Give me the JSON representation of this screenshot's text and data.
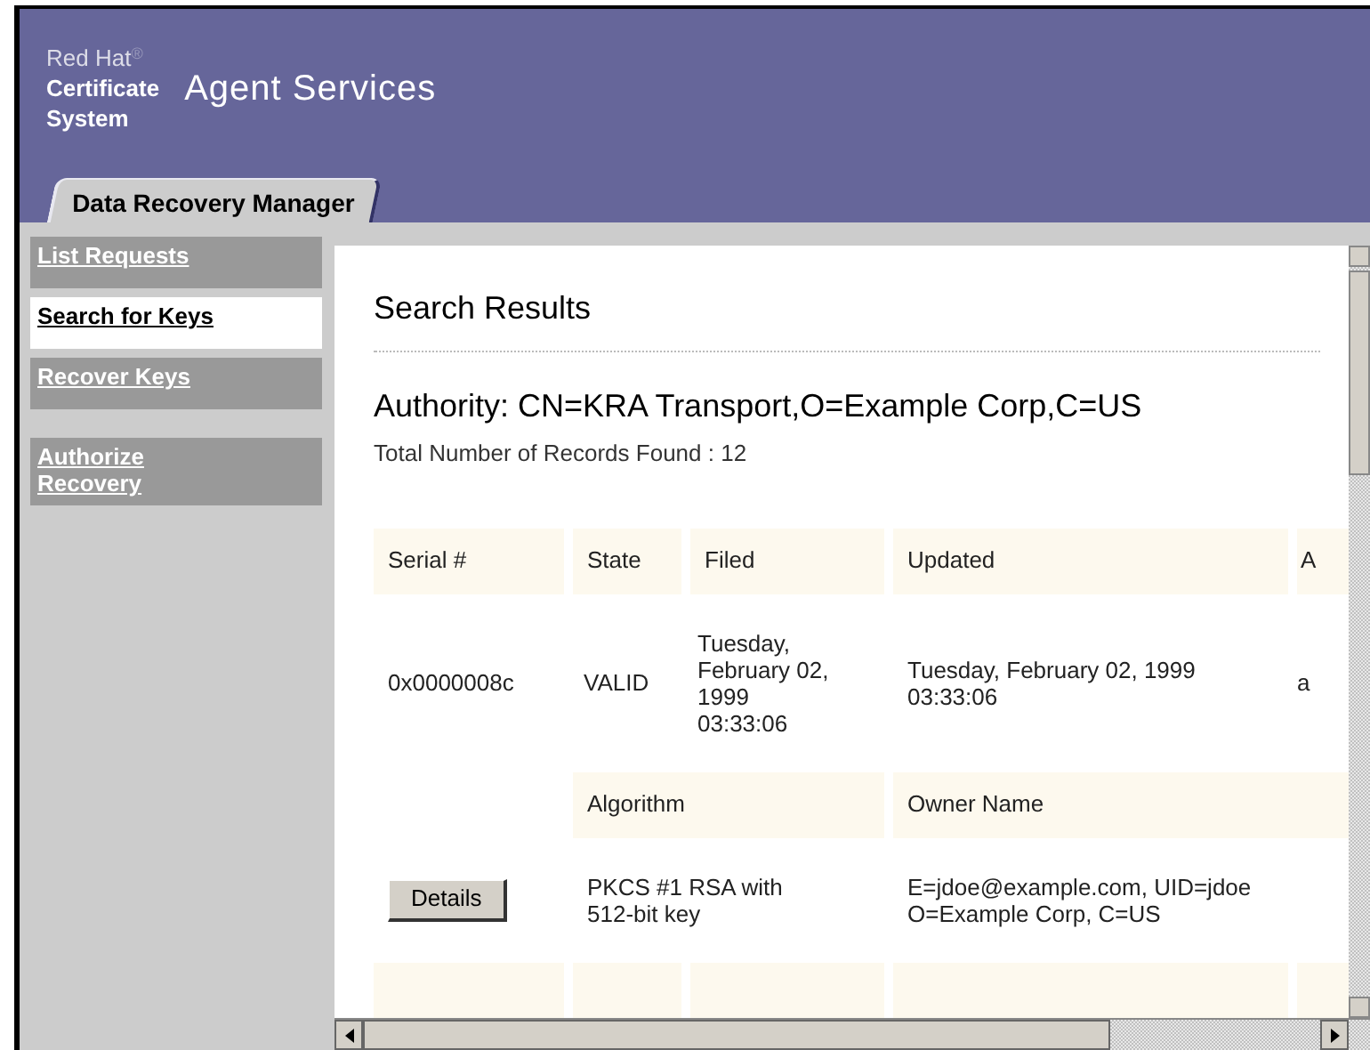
{
  "header": {
    "brand_lines": [
      "Red Hat$^{®}$",
      "Certificate",
      "System"
    ],
    "title": "Agent Services"
  },
  "tabs": [
    {
      "label": "Data Recovery Manager",
      "selected": true
    }
  ],
  "sidebar": {
    "groups": [
      [
        {
          "label": "List Requests",
          "selected": false
        },
        {
          "label": "Search for Keys",
          "selected": true
        },
        {
          "label": "Recover Keys",
          "selected": false
        }
      ],
      [
        {
          "label": "Authorize Recovery",
          "selected": false
        }
      ]
    ]
  },
  "content": {
    "title": "Search Results",
    "authority": "Authority: CN=KRA Transport,O=Example Corp,C=US",
    "total": "Total Number of Records Found : 12"
  },
  "table": {
    "columns": [
      "Serial #",
      "State",
      "Filed",
      "Updated",
      "A"
    ],
    "detail_columns": [
      "Algorithm",
      "Owner Name"
    ],
    "records": [
      {
        "serial": "0x0000008c",
        "state": "VALID",
        "filed": "Tuesday,\nFebruary 02,\n1999\n03:33:06",
        "updated": "Tuesday, February 02, 1999\n03:33:06",
        "column_5": "a",
        "button": "Details",
        "algorithm": "PKCS #1 RSA with\n512-bit key",
        "owner_name": "E=jdoe@example.com, UID=jdoe\nO=Example Corp, C=US"
      }
    ]
  }
}
